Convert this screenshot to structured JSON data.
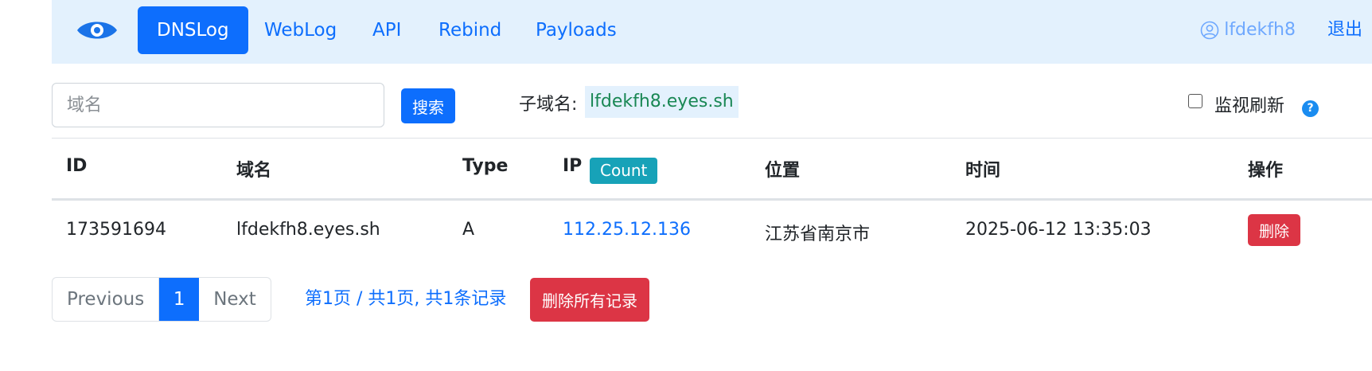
{
  "nav": {
    "items": [
      {
        "label": "DNSLog",
        "active": true
      },
      {
        "label": "WebLog",
        "active": false
      },
      {
        "label": "API",
        "active": false
      },
      {
        "label": "Rebind",
        "active": false
      },
      {
        "label": "Payloads",
        "active": false
      }
    ],
    "username": "lfdekfh8",
    "logout_label": "退出"
  },
  "search": {
    "placeholder": "域名",
    "value": "",
    "button_label": "搜索"
  },
  "subdomain": {
    "label": "子域名:",
    "value": "lfdekfh8.eyes.sh"
  },
  "monitor": {
    "label": "监视刷新",
    "checked": false,
    "help": "?"
  },
  "table": {
    "headers": {
      "id": "ID",
      "domain": "域名",
      "type": "Type",
      "ip": "IP",
      "count_badge": "Count",
      "location": "位置",
      "time": "时间",
      "action": "操作"
    },
    "rows": [
      {
        "id": "173591694",
        "domain": "lfdekfh8.eyes.sh",
        "type": "A",
        "ip": "112.25.12.136",
        "location": "江苏省南京市",
        "time": "2025-06-12 13:35:03",
        "delete_label": "删除"
      }
    ]
  },
  "pagination": {
    "previous": "Previous",
    "current": "1",
    "next": "Next",
    "info": "第1页 / 共1页, 共1条记录",
    "delete_all_label": "删除所有记录"
  },
  "colors": {
    "primary": "#0d6efd",
    "navbar_bg": "#e3f1fd",
    "danger": "#dc3545",
    "info_badge": "#17a2b8",
    "subdomain_text": "#198754"
  }
}
